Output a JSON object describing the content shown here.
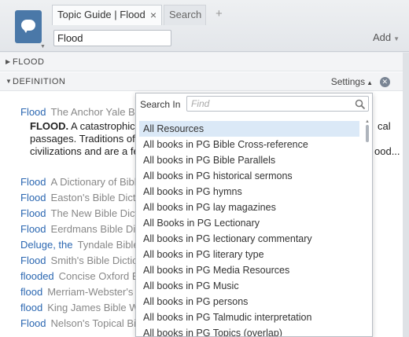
{
  "tabs": {
    "active_label": "Topic Guide | Flood",
    "close_glyph": "×",
    "search_label": "Search",
    "add_glyph": "+"
  },
  "topic_input": {
    "value": "Flood"
  },
  "add_menu": {
    "label": "Add"
  },
  "sections": {
    "flood": "FLOOD",
    "definition": "DEFINITION",
    "settings_label": "Settings"
  },
  "definition": {
    "term": "Flood",
    "source": "The Anchor Yale Bibl",
    "headword": "FLOOD.",
    "line1": "A catastrophic de",
    "line1_end": "cal",
    "line2": "passages. Traditions of a",
    "line3": "civilizations and are a fea",
    "line3_end": "ood..."
  },
  "results": [
    {
      "term": "Flood",
      "source": "A Dictionary of Biblic"
    },
    {
      "term": "Flood",
      "source": "Easton's Bible Dictio"
    },
    {
      "term": "Flood",
      "source": "The New Bible Dictio"
    },
    {
      "term": "Flood",
      "source": "Eerdmans Bible Dict"
    },
    {
      "term": "Deluge, the",
      "source": "Tyndale Bible D"
    },
    {
      "term": "Flood",
      "source": "Smith's Bible Diction"
    },
    {
      "term": "flooded",
      "source": "Concise Oxford En"
    },
    {
      "term": "flood",
      "source": "Merriam-Webster's C"
    },
    {
      "term": "flood",
      "source": "King James Bible Wo"
    },
    {
      "term": "Flood",
      "source": "Nelson's Topical Bibl"
    }
  ],
  "popup": {
    "label": "Search In",
    "placeholder": "Find",
    "items": [
      "All Resources",
      "All books in PG Bible Cross-reference",
      "All books in PG Bible Parallels",
      "All books in PG historical sermons",
      "All books in PG hymns",
      "All books in PG lay magazines",
      "All Books in PG Lectionary",
      "All books in PG lectionary commentary",
      "All books in PG literary type",
      "All books in PG Media Resources",
      "All books in PG Music",
      "All books in PG persons",
      "All books in PG Talmudic interpretation",
      "All books in PG Topics (overlap)"
    ],
    "selected_index": 0
  },
  "colors": {
    "link": "#2b67b1",
    "selected_bg": "#dbe9f7",
    "logo": "#4a78a8"
  }
}
